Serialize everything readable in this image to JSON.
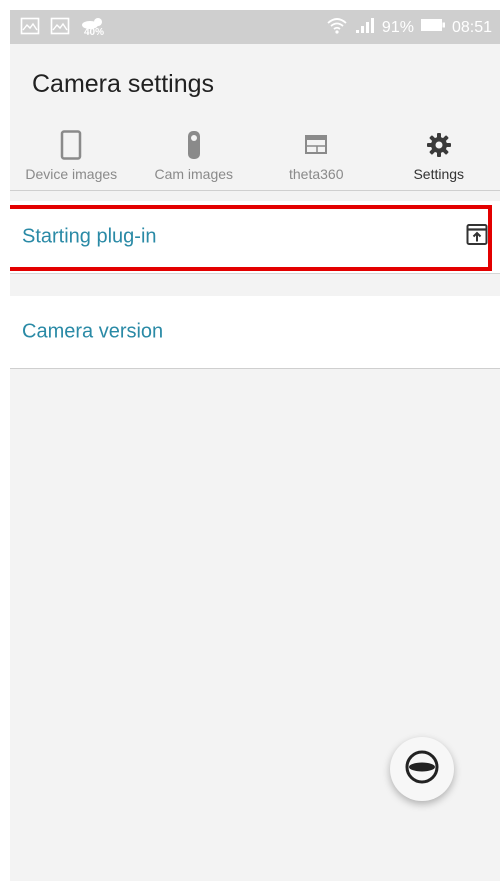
{
  "status_bar": {
    "weather_percent": "40%",
    "battery_percent": "91%",
    "time": "08:51",
    "icons": [
      "image-icon",
      "image-icon",
      "weather-icon",
      "wifi-icon",
      "signal-icon",
      "battery-icon"
    ]
  },
  "header": {
    "title": "Camera settings"
  },
  "tabs": [
    {
      "label": "Device images",
      "icon": "phone-icon",
      "active": false
    },
    {
      "label": "Cam images",
      "icon": "camera-icon",
      "active": false
    },
    {
      "label": "theta360",
      "icon": "browser-window-icon",
      "active": false
    },
    {
      "label": "Settings",
      "icon": "gear-icon",
      "active": true
    }
  ],
  "list": {
    "items": [
      {
        "label": "Starting plug-in",
        "icon": "open-in-new-icon"
      },
      {
        "label": "Camera version"
      }
    ]
  },
  "fab": {
    "icon": "theta-camera-icon"
  },
  "colors": {
    "status_bar_bg": "#cfcfcf",
    "background": "#f3f3f3",
    "accent_text": "#2a8aa6",
    "highlight_border": "#e30000"
  }
}
